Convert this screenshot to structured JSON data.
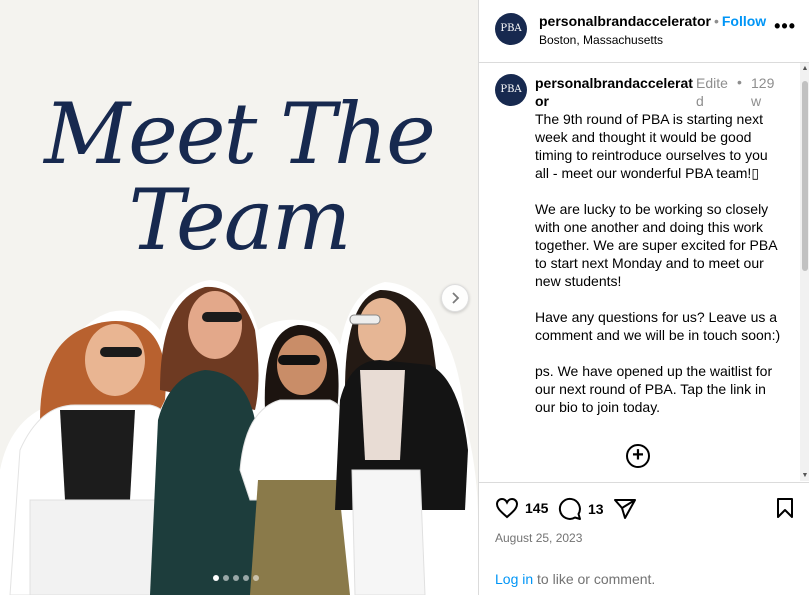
{
  "post": {
    "headline_line1": "Meet The",
    "headline_line2": "Team",
    "carousel_pages": 5,
    "carousel_active": 1
  },
  "header": {
    "avatar_text": "PBA",
    "username": "personalbrandaccelerator",
    "separator": "•",
    "follow_label": "Follow",
    "location": "Boston, Massachusetts",
    "more_label": "•••"
  },
  "caption": {
    "username": "personalbrandaccelerator",
    "edited": "Edited",
    "separator": "•",
    "time": "129w",
    "paragraphs": [
      "The 9th round of PBA is starting next week and thought it would be good timing to reintroduce ourselves to you all - meet our wonderful PBA team!▯",
      "We are lucky to be working so closely with one another and doing this work together. We are super excited for PBA to start next Monday and to meet our new students!",
      "Have any questions for us? Leave us a comment and we will be in touch soon:)",
      "ps. We have opened up the waitlist for our next round of PBA. Tap the link in our bio to join today."
    ],
    "load_more": "+"
  },
  "actions": {
    "likes": "145",
    "comments": "13",
    "date": "August 25, 2023",
    "login_link": "Log in",
    "login_rest": " to like or comment."
  },
  "colors": {
    "brand_navy": "#17294f",
    "link_blue": "#0095f6",
    "image_bg": "#f4f3ef"
  }
}
